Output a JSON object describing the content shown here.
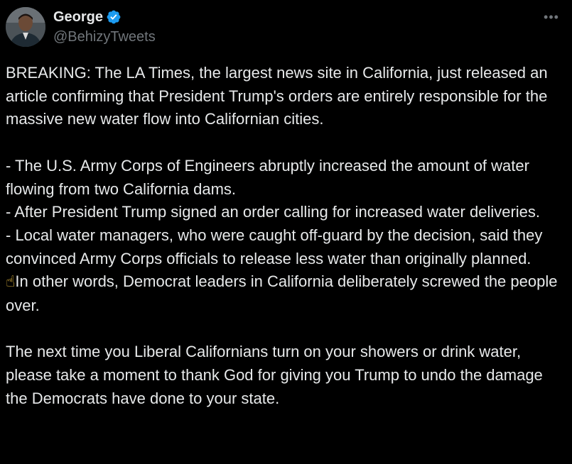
{
  "author": {
    "display_name": "George",
    "handle": "@BehizyTweets",
    "verified": true,
    "verified_color": "#1d9bf0"
  },
  "more_icon": "more-horizontal-icon",
  "tweet": {
    "paragraphs": [
      "BREAKING: The LA Times, the largest news site in California, just released an article confirming that President Trump's orders are entirely responsible for the massive new water flow into Californian cities.",
      "- The U.S. Army Corps of Engineers abruptly increased the amount of water flowing from two California dams.\n- After President Trump signed an order calling for increased water deliveries.\n- Local water managers, who were caught off-guard by the decision, said they convinced Army Corps officials to release less water than originally planned.",
      "In other words, Democrat leaders in California deliberately screwed the people over.",
      "The next time you Liberal Californians turn on your showers or drink water, please take a moment to thank God for giving you Trump to undo the damage the Democrats have done to your state."
    ],
    "pointing_emoji": "☝"
  },
  "colors": {
    "background": "#000000",
    "text": "#e7e9ea",
    "secondary_text": "#71767b"
  }
}
